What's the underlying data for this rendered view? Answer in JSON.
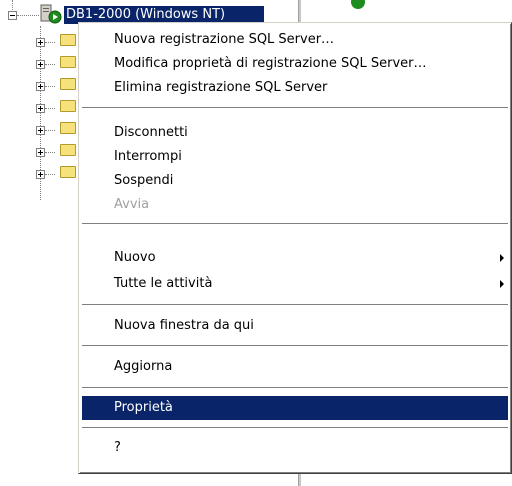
{
  "tree": {
    "root_label": "DB1-2000 (Windows NT)",
    "icons": {
      "root": "sql-server-running-icon",
      "child": "folder-icon"
    }
  },
  "context_menu": {
    "items": [
      {
        "label": "Nuova registrazione SQL Server…",
        "enabled": true
      },
      {
        "label": "Modifica proprietà di registrazione SQL Server…",
        "enabled": true
      },
      {
        "label": "Elimina registrazione SQL Server",
        "enabled": true
      },
      {
        "label": "Disconnetti",
        "enabled": true
      },
      {
        "label": "Interrompi",
        "enabled": true
      },
      {
        "label": "Sospendi",
        "enabled": true
      },
      {
        "label": "Avvia",
        "enabled": false
      },
      {
        "label": "Nuovo",
        "enabled": true,
        "submenu": true
      },
      {
        "label": "Tutte le attività",
        "enabled": true,
        "submenu": true
      },
      {
        "label": "Nuova finestra da qui",
        "enabled": true
      },
      {
        "label": "Aggiorna",
        "enabled": true
      },
      {
        "label": "Proprietà",
        "enabled": true,
        "selected": true
      },
      {
        "label": "?",
        "enabled": true
      }
    ]
  },
  "colors": {
    "selection": "#0a246a",
    "disabled_text": "#a0a0a0",
    "folder": "#f5e27a"
  }
}
